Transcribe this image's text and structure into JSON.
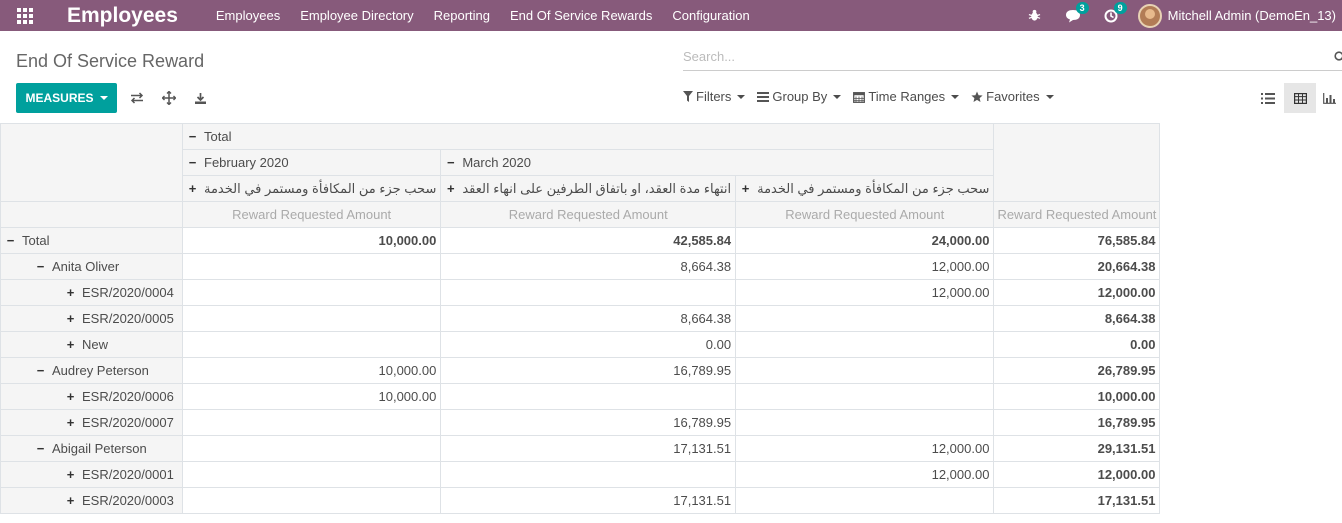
{
  "navbar": {
    "app_name": "Employees",
    "menu": [
      "Employees",
      "Employee Directory",
      "Reporting",
      "End Of Service Rewards",
      "Configuration"
    ],
    "chat_badge": "3",
    "activity_badge": "9",
    "user": "Mitchell Admin (DemoEn_13)"
  },
  "control_panel": {
    "title": "End Of Service Reward",
    "search_placeholder": "Search...",
    "measures_label": "MEASURES",
    "filters_label": "Filters",
    "group_by_label": "Group By",
    "time_ranges_label": "Time Ranges",
    "favorites_label": "Favorites"
  },
  "pivot": {
    "col_total": "Total",
    "col_groups": [
      "February 2020",
      "March 2020"
    ],
    "col_subgroups": [
      "سحب جزء من المكافأة ومستمر في الخدمة",
      "انتهاء مدة العقد، او باتفاق الطرفين على انهاء العقد",
      "سحب جزء من المكافأة ومستمر في الخدمة"
    ],
    "measure": "Reward Requested Amount",
    "rows": [
      {
        "label": "Total",
        "values": [
          "10,000.00",
          "42,585.84",
          "24,000.00",
          "76,585.84"
        ]
      },
      {
        "label": "Anita Oliver",
        "values": [
          "",
          "8,664.38",
          "12,000.00",
          "20,664.38"
        ]
      },
      {
        "label": "ESR/2020/0004",
        "values": [
          "",
          "",
          "12,000.00",
          "12,000.00"
        ]
      },
      {
        "label": "ESR/2020/0005",
        "values": [
          "",
          "8,664.38",
          "",
          "8,664.38"
        ]
      },
      {
        "label": "New",
        "values": [
          "",
          "0.00",
          "",
          "0.00"
        ]
      },
      {
        "label": "Audrey Peterson",
        "values": [
          "10,000.00",
          "16,789.95",
          "",
          "26,789.95"
        ]
      },
      {
        "label": "ESR/2020/0006",
        "values": [
          "10,000.00",
          "",
          "",
          "10,000.00"
        ]
      },
      {
        "label": "ESR/2020/0007",
        "values": [
          "",
          "16,789.95",
          "",
          "16,789.95"
        ]
      },
      {
        "label": "Abigail Peterson",
        "values": [
          "",
          "17,131.51",
          "12,000.00",
          "29,131.51"
        ]
      },
      {
        "label": "ESR/2020/0001",
        "values": [
          "",
          "",
          "12,000.00",
          "12,000.00"
        ]
      },
      {
        "label": "ESR/2020/0003",
        "values": [
          "",
          "17,131.51",
          "",
          "17,131.51"
        ]
      }
    ]
  }
}
